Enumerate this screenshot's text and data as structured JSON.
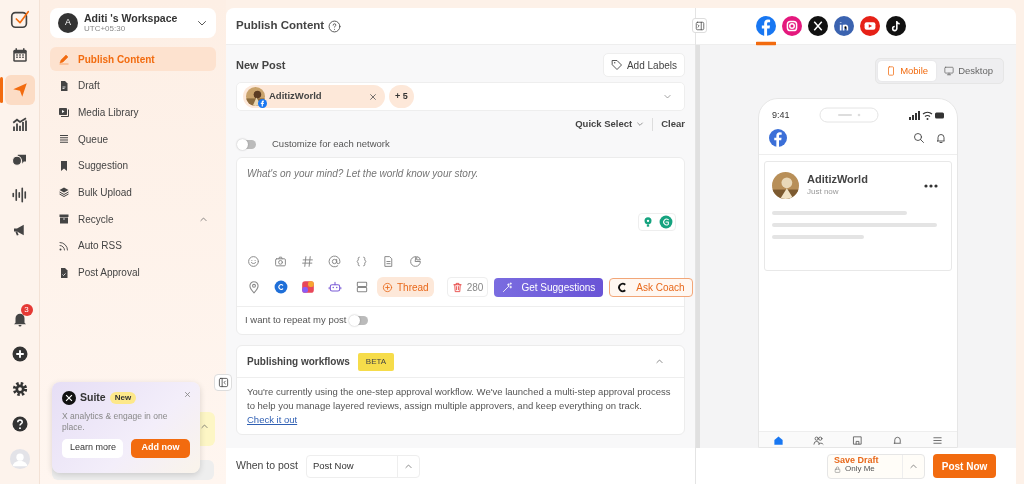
{
  "rail": {
    "items": [
      {
        "selected": false
      },
      {
        "selected": true
      },
      {
        "selected": false
      },
      {
        "selected": false
      },
      {
        "selected": false
      },
      {
        "selected": false
      }
    ],
    "notifications": "3"
  },
  "workspace": {
    "name": "Aditi 's Workspace",
    "initial": "A",
    "timezone": "UTC+05:30"
  },
  "nav": [
    {
      "label": "Publish Content",
      "selected": true
    },
    {
      "label": "Draft",
      "selected": false
    },
    {
      "label": "Media Library",
      "selected": false
    },
    {
      "label": "Queue",
      "selected": false
    },
    {
      "label": "Suggestion",
      "selected": false
    },
    {
      "label": "Bulk Upload",
      "selected": false
    },
    {
      "label": "Recycle",
      "selected": false,
      "expanded": true
    },
    {
      "label": "Auto RSS",
      "selected": false
    },
    {
      "label": "Post Approval",
      "selected": false
    }
  ],
  "promo": {
    "title": "Suite",
    "badge": "New",
    "text": "X analytics & engage in one place.",
    "buttons": [
      "Learn more",
      "Add now"
    ]
  },
  "header": {
    "title": "Publish Content"
  },
  "composer": {
    "title": "New Post",
    "add_labels": "Add Labels",
    "account": "AditizWorld",
    "more_accounts": "+ 5",
    "quick_select": "Quick Select",
    "clear": "Clear",
    "customize": {
      "label": "Customize for each network",
      "on": false
    },
    "placeholder": "What's on your mind? Let the world know your story.",
    "thread": "Thread",
    "counter": "280",
    "get_suggestions": "Get Suggestions",
    "ask_coach": "Ask Coach",
    "repeat": {
      "label": "I want to repeat my post",
      "on": false
    }
  },
  "workflows": {
    "title": "Publishing workflows",
    "badge": "BETA",
    "expanded": true,
    "text": "You're currently using the one-step approval workflow. We've launched a multi-step approval process to help you manage layered reviews, assign multiple approvers, and keep everything on track.",
    "link": "Check it out"
  },
  "schedule": {
    "label": "When to post",
    "value": "Post Now"
  },
  "preview": {
    "networks": [
      {
        "selected": true
      },
      {
        "selected": false
      },
      {
        "selected": false
      },
      {
        "selected": false
      },
      {
        "selected": false
      },
      {
        "selected": false
      }
    ],
    "modes": [
      {
        "label": "Mobile",
        "selected": true
      },
      {
        "label": "Desktop",
        "selected": false
      }
    ],
    "phone": {
      "time": "9:41",
      "author": "AditizWorld",
      "posted": "Just now"
    }
  },
  "footer": {
    "save_draft": "Save Draft",
    "visibility": "Only Me",
    "post_now": "Post Now"
  }
}
